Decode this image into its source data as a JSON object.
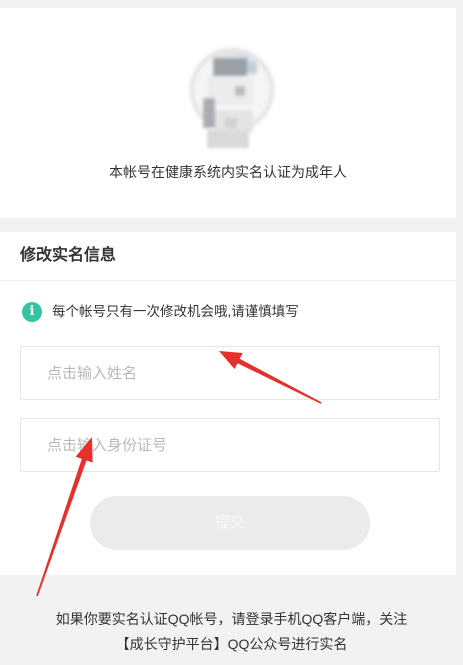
{
  "status": {
    "avatar_icon": "blurred-avatar-image",
    "text": "本帐号在健康系统内实名认证为成年人"
  },
  "form": {
    "title": "修改实名信息",
    "notice": {
      "icon": "info-icon",
      "icon_glyph": "i",
      "text": "每个帐号只有一次修改机会哦,请谨慎填写"
    },
    "name_input": {
      "placeholder": "点击输入姓名",
      "value": ""
    },
    "id_input": {
      "placeholder": "点击输入身份证号",
      "value": ""
    },
    "submit": {
      "label": "提交",
      "enabled": false
    }
  },
  "footer": {
    "lines": [
      "如果你要实名认证QQ帐号，请登录手机QQ客户端，关注",
      "【成长守护平台】QQ公众号进行实名"
    ]
  },
  "annotations": {
    "arrow_icon": "red-arrow-annotation"
  },
  "colors": {
    "page_background": "#f2f2f2",
    "card_background": "#ffffff",
    "text": "#333333",
    "placeholder": "#b8b8b8",
    "accent": "#35c4a0",
    "submit_background": "#ebebeb",
    "submit_text": "#f8f8f8",
    "annotation_red": "#e5302b"
  }
}
